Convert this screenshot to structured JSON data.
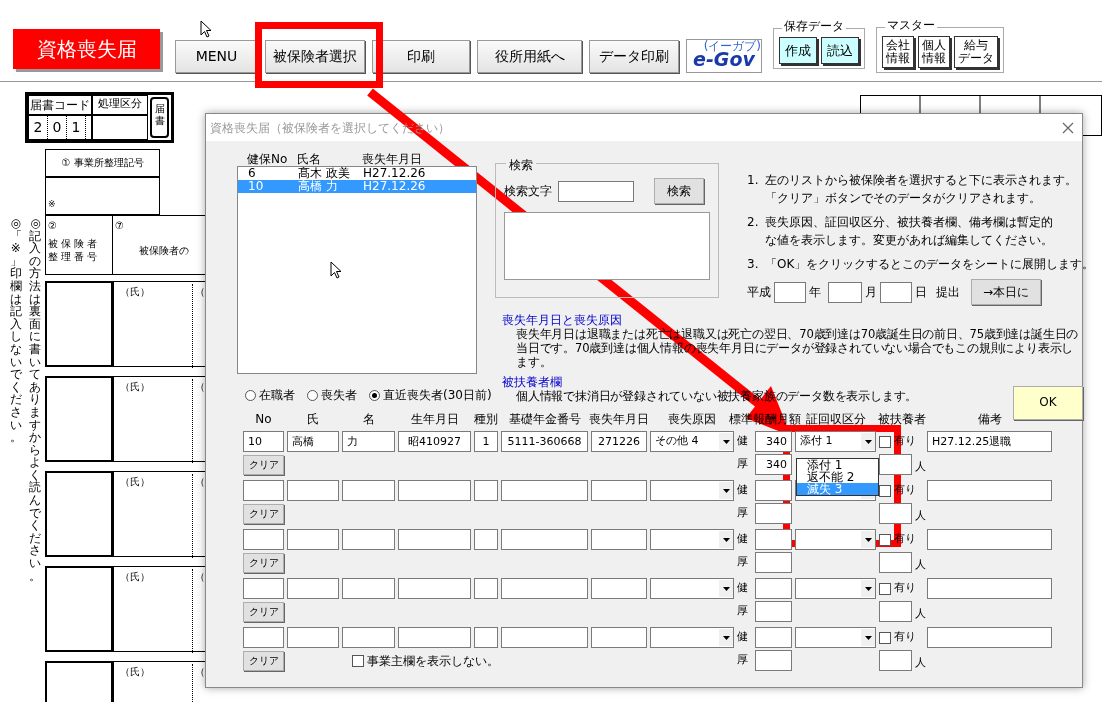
{
  "app_title": "資格喪失届",
  "toolbar": [
    {
      "label": "MENU"
    },
    {
      "label": "被保険者選択"
    },
    {
      "label": "印刷"
    },
    {
      "label": "役所用紙へ"
    },
    {
      "label": "データ印刷"
    }
  ],
  "egov": {
    "logo": "e-Gov",
    "reading": "(イーガブ)"
  },
  "save_data": {
    "title": "保存データ",
    "buttons": [
      "作成",
      "読込"
    ]
  },
  "master": {
    "title": "マスター",
    "buttons": [
      [
        "会社",
        "情報"
      ],
      [
        "個人",
        "情報"
      ],
      [
        "給与",
        "データ"
      ]
    ]
  },
  "form": {
    "code_header": "届書コード",
    "process_header": "処理区分",
    "code_digits": [
      "2",
      "0",
      "1"
    ],
    "tag": "届書",
    "office_label": "① 事業所整理記号",
    "note_mark": "※",
    "insured_no_mark": "②",
    "insured_no_label": "被保険者整理番号",
    "insured_name_mark": "⑦",
    "insured_name_label": "被保険者の",
    "vertical_notes": [
      "◎「※」印欄は記入しないでください。",
      "◎記入の方法は裏面に書いてありますからよく読んでください。"
    ],
    "rows": [
      {
        "surname": "（氏）",
        "given": "（"
      },
      {
        "surname": "（氏）",
        "given": "（"
      },
      {
        "surname": "（氏）",
        "given": "（"
      },
      {
        "surname": "（氏）",
        "given": "（"
      },
      {
        "surname": "（氏）",
        "given": "（"
      }
    ]
  },
  "dialog": {
    "title": "資格喪失届（被保険者を選択してください）",
    "list": {
      "columns": [
        "健保No",
        "氏名",
        "喪失年月日"
      ],
      "items": [
        {
          "no": "6",
          "name": "髙木 政美",
          "date": "H27.12.26",
          "selected": false
        },
        {
          "no": "10",
          "name": "高橋 力",
          "date": "H27.12.26",
          "selected": true
        }
      ]
    },
    "filters": [
      {
        "label": "在職者",
        "selected": false
      },
      {
        "label": "喪失者",
        "selected": false
      },
      {
        "label": "直近喪失者(30日前)",
        "selected": true
      }
    ],
    "search": {
      "group": "検索",
      "label": "検索文字",
      "button": "検索"
    },
    "instructions": [
      {
        "num": "1.",
        "lines": [
          "左のリストから被保険者を選択すると下に表示されます。",
          "「クリア」ボタンでそのデータがクリアされます。"
        ]
      },
      {
        "num": "2.",
        "lines": [
          "喪失原因、証回収区分、被扶養者欄、備考欄は暫定的",
          "な値を表示します。変更があれば編集してください。"
        ]
      },
      {
        "num": "3.",
        "lines": [
          "「OK」をクリックするとこのデータをシートに展開します。"
        ]
      }
    ],
    "date_row": {
      "era": "平成",
      "year": "年",
      "month": "月",
      "day": "日",
      "submit": "提出",
      "today_button": "→本日に"
    },
    "notes": [
      {
        "heading": "喪失年月日と喪失原因",
        "text": "喪失年月日は退職または死亡は退職又は死亡の翌日、70歳到達は70歳誕生日の前日、75歳到達は誕生日の当日です。70歳到達は個人情報の喪失年月日にデータが登録されていない場合でもこの規則により表示します。"
      },
      {
        "heading": "被扶養者欄",
        "text": "個人情報で抹消日が登録されていない被扶養家族のデータ数を表示します。"
      }
    ],
    "ok_button": "OK",
    "columns": [
      "No",
      "氏",
      "名",
      "生年月日",
      "種別",
      "基礎年金番号",
      "喪失年月日",
      "喪失原因",
      "標準報酬月額",
      "証回収区分",
      "被扶養者",
      "備考"
    ],
    "rows": [
      {
        "no": "10",
        "surname": "高橋",
        "given": "力",
        "birth": "昭410927",
        "type": "1",
        "pension_no": "5111-360668",
        "loss_date": "271226",
        "reason": "その他 4",
        "health_label": "健",
        "health_amount": "340",
        "pension_label": "厚",
        "pension_amount": "340",
        "cert": "添付 1",
        "dependents_checked": false,
        "dependents_label": "有り",
        "people_label": "人",
        "remarks": "H27.12.25退職",
        "clear_button": "クリア"
      },
      {
        "health_label": "健",
        "pension_label": "厚",
        "dependents_checked": false,
        "dependents_label": "有り",
        "people_label": "人",
        "clear_button": "クリア"
      },
      {
        "health_label": "健",
        "pension_label": "厚",
        "dependents_checked": false,
        "dependents_label": "有り",
        "people_label": "人",
        "clear_button": "クリア"
      },
      {
        "health_label": "健",
        "pension_label": "厚",
        "dependents_checked": false,
        "dependents_label": "有り",
        "people_label": "人",
        "clear_button": "クリア"
      },
      {
        "health_label": "健",
        "pension_label": "厚",
        "dependents_checked": false,
        "dependents_label": "有り",
        "people_label": "人",
        "clear_button": "クリア"
      }
    ],
    "dropdown": {
      "options": [
        {
          "label": "添付 1",
          "selected": false
        },
        {
          "label": "返不能 2",
          "selected": false
        },
        {
          "label": "滅失 3",
          "selected": true
        }
      ]
    },
    "hide_employer": {
      "label": "事業主欄を表示しない。",
      "checked": false
    }
  }
}
